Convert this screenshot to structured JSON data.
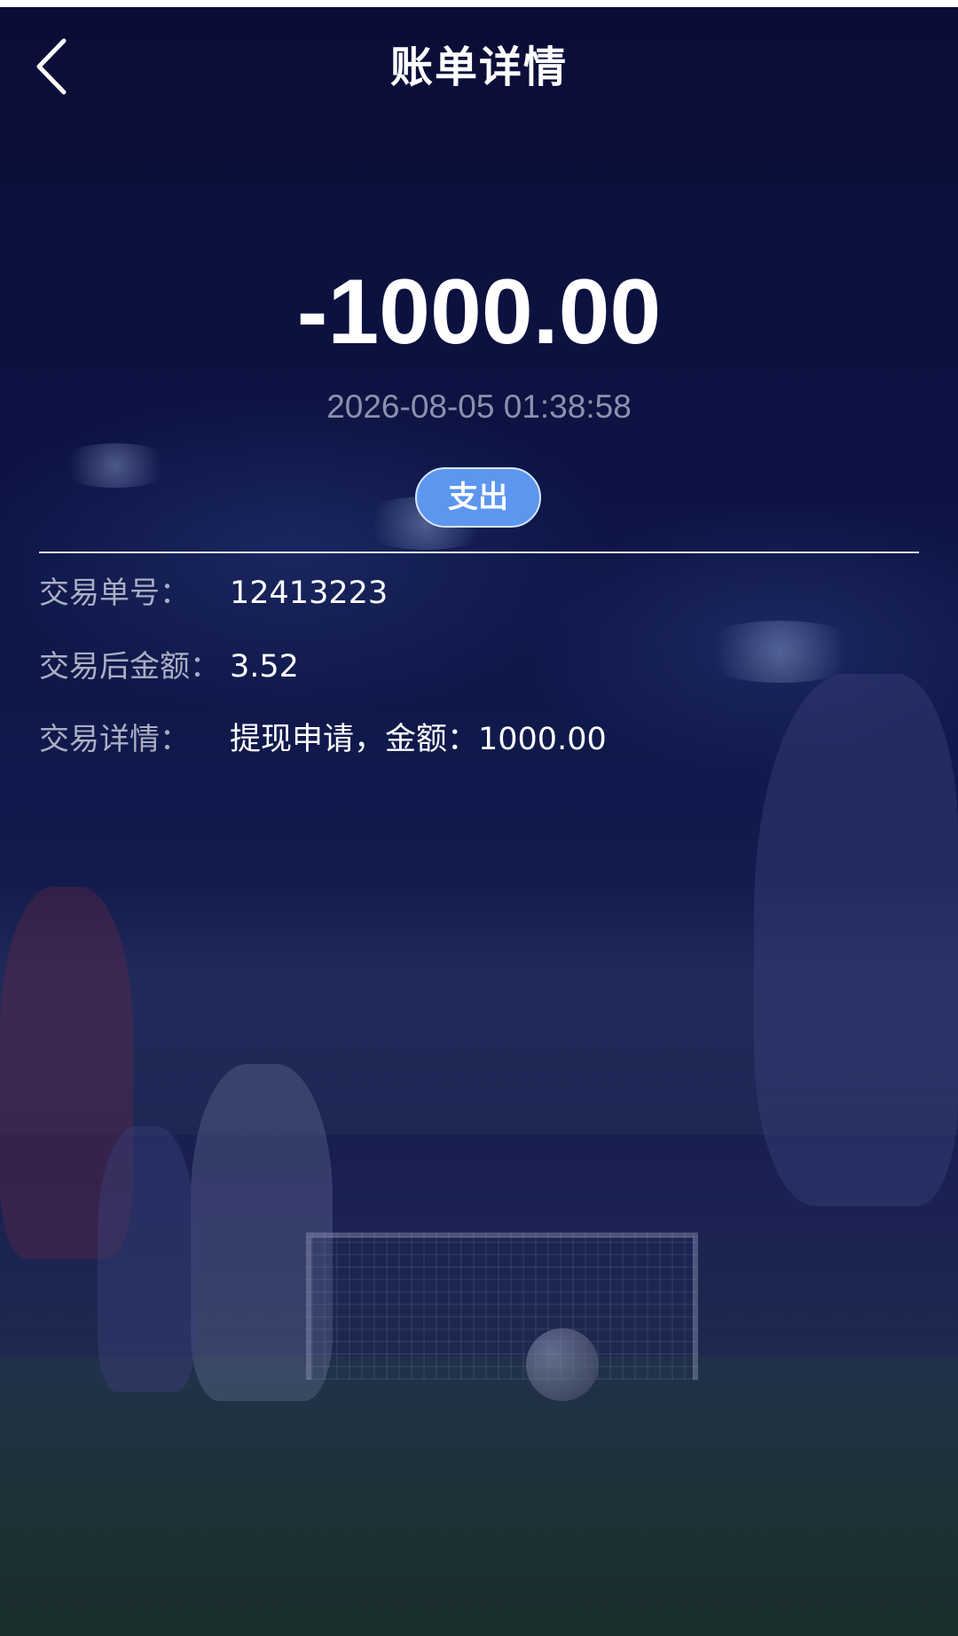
{
  "header": {
    "title": "账单详情",
    "back_icon": "chevron-left-icon"
  },
  "transaction": {
    "amount": "-1000.00",
    "datetime": "2026-08-05 01:38:58",
    "type_label": "支出",
    "type_color": "#5d96ee"
  },
  "details": [
    {
      "label": "交易单号：",
      "value": "12413223"
    },
    {
      "label": "交易后金额：",
      "value": "3.52"
    },
    {
      "label": "交易详情：",
      "value": "提现申请，金额：1000.00"
    }
  ],
  "colors": {
    "background": "#0b0f3a",
    "text_primary": "#ffffff",
    "text_secondary": "#a9aec4",
    "accent": "#5d96ee"
  }
}
